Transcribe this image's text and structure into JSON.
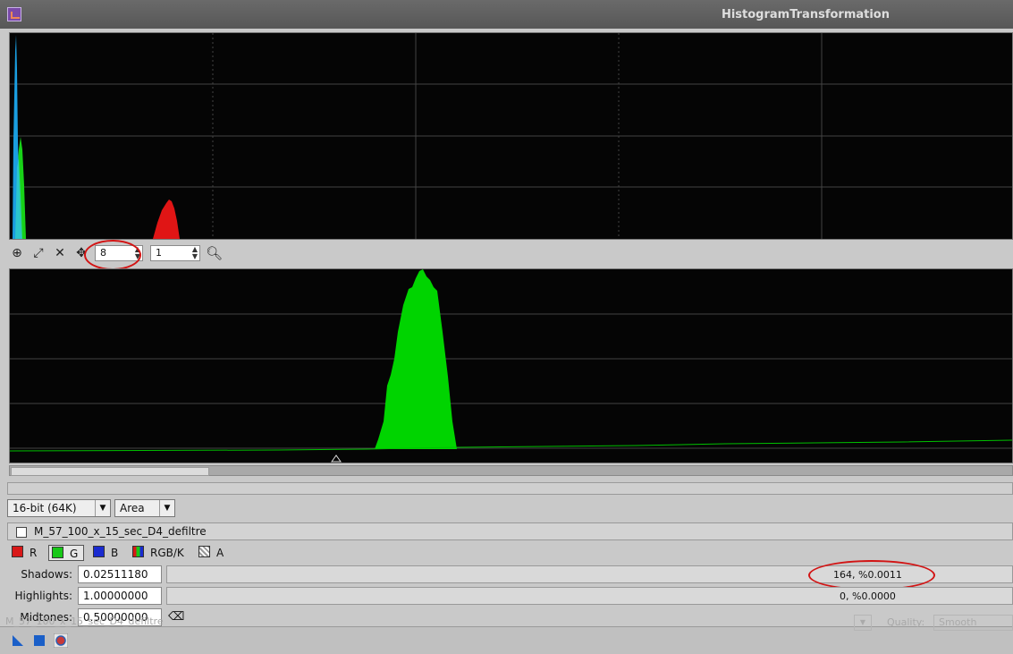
{
  "window": {
    "title": "HistogramTransformation"
  },
  "toolbar": {
    "zoom_x": "8",
    "zoom_y": "1",
    "icons": [
      "crosshair-icon",
      "zoom-fit-icon",
      "zoom-out-icon",
      "pan-icon",
      "magnifier-icon"
    ]
  },
  "options": {
    "resolution": "16-bit (64K)",
    "graph_style": "Area"
  },
  "view": {
    "image_name": "M_57_100_x_15_sec_D4_defiltre"
  },
  "channels": [
    {
      "label": "R",
      "color": "#d81818"
    },
    {
      "label": "G",
      "color": "#18c818",
      "selected": true
    },
    {
      "label": "B",
      "color": "#1a2bd0"
    },
    {
      "label": "RGB/K",
      "color": "#6a3"
    },
    {
      "label": "A",
      "color": "#ffffff"
    }
  ],
  "params": {
    "shadows": {
      "label": "Shadows:",
      "value": "0.02511180",
      "clip_readout": "164, %0.0011"
    },
    "highlights": {
      "label": "Highlights:",
      "value": "1.00000000",
      "clip_readout": "0, %0.0000"
    },
    "midtones": {
      "label": "Midtones:",
      "value": "0.50000000"
    }
  },
  "bottom": {
    "ghost_view": "M_57_100_x_15_sec_D4_defiltre",
    "quality_label": "Quality:",
    "quality_value": "Smooth"
  },
  "colors": {
    "red_channel": "#e01515",
    "green_channel": "#00d400",
    "blue_channel": "#1aa0e0",
    "cyan_overlap": "#30d0c0",
    "annotation": "#d21414"
  }
}
